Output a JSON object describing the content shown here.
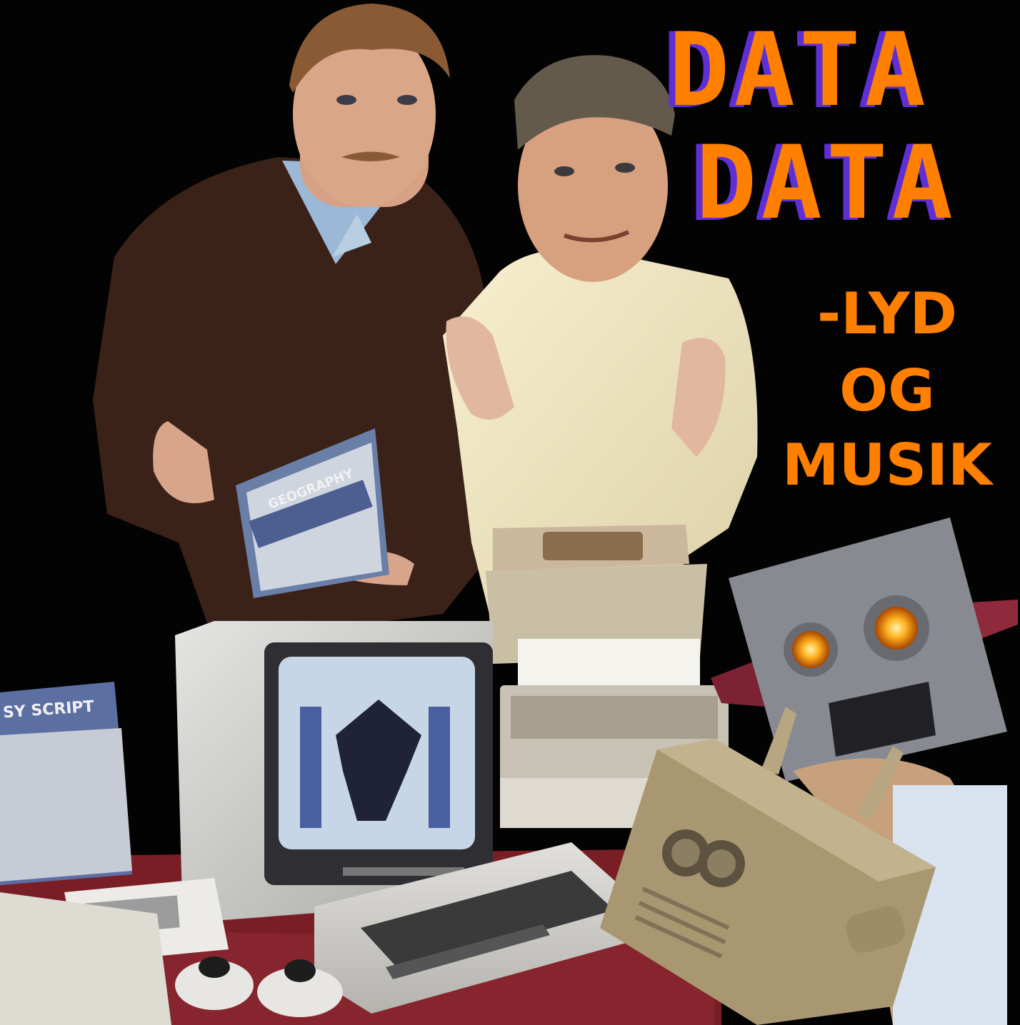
{
  "title": {
    "line1": "DATA",
    "line2": "DATA"
  },
  "subtitle": {
    "line1": "-LYD",
    "line2": "OG",
    "line3": "MUSIK"
  },
  "props": {
    "left_box_text": "SY SCRIPT",
    "book_title": "GEOGRAPHY"
  },
  "colors": {
    "background": "#030303",
    "title_fill": "#ff7f00",
    "title_shadow": "#5f2fd6",
    "subtitle_fill": "#ff7f00"
  }
}
